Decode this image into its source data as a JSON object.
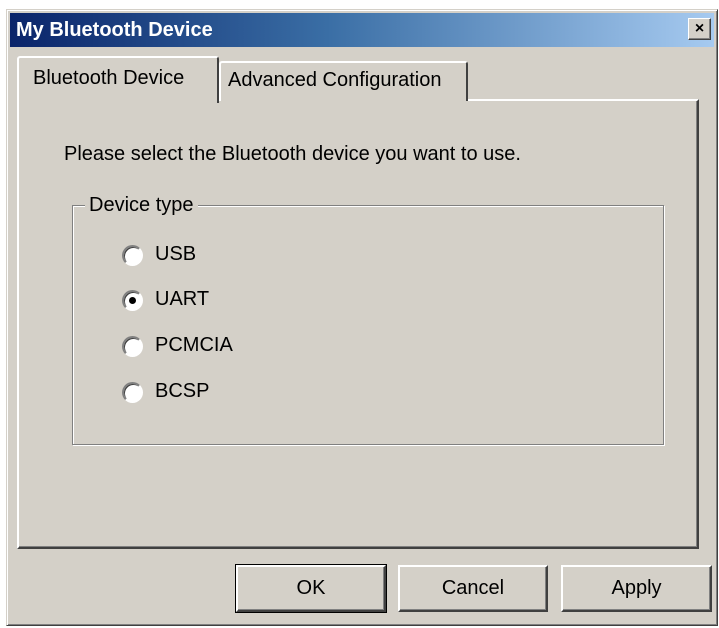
{
  "window": {
    "title": "My Bluetooth Device",
    "close_label": "×"
  },
  "tabs": [
    {
      "label": "Bluetooth Device",
      "active": true
    },
    {
      "label": "Advanced Configuration",
      "active": false
    }
  ],
  "main": {
    "instruction": "Please select the Bluetooth device you want to use.",
    "group_label": "Device type",
    "options": [
      {
        "label": "USB",
        "selected": false
      },
      {
        "label": "UART",
        "selected": true
      },
      {
        "label": "PCMCIA",
        "selected": false
      },
      {
        "label": "BCSP",
        "selected": false
      }
    ]
  },
  "buttons": {
    "ok": "OK",
    "cancel": "Cancel",
    "apply": "Apply"
  }
}
